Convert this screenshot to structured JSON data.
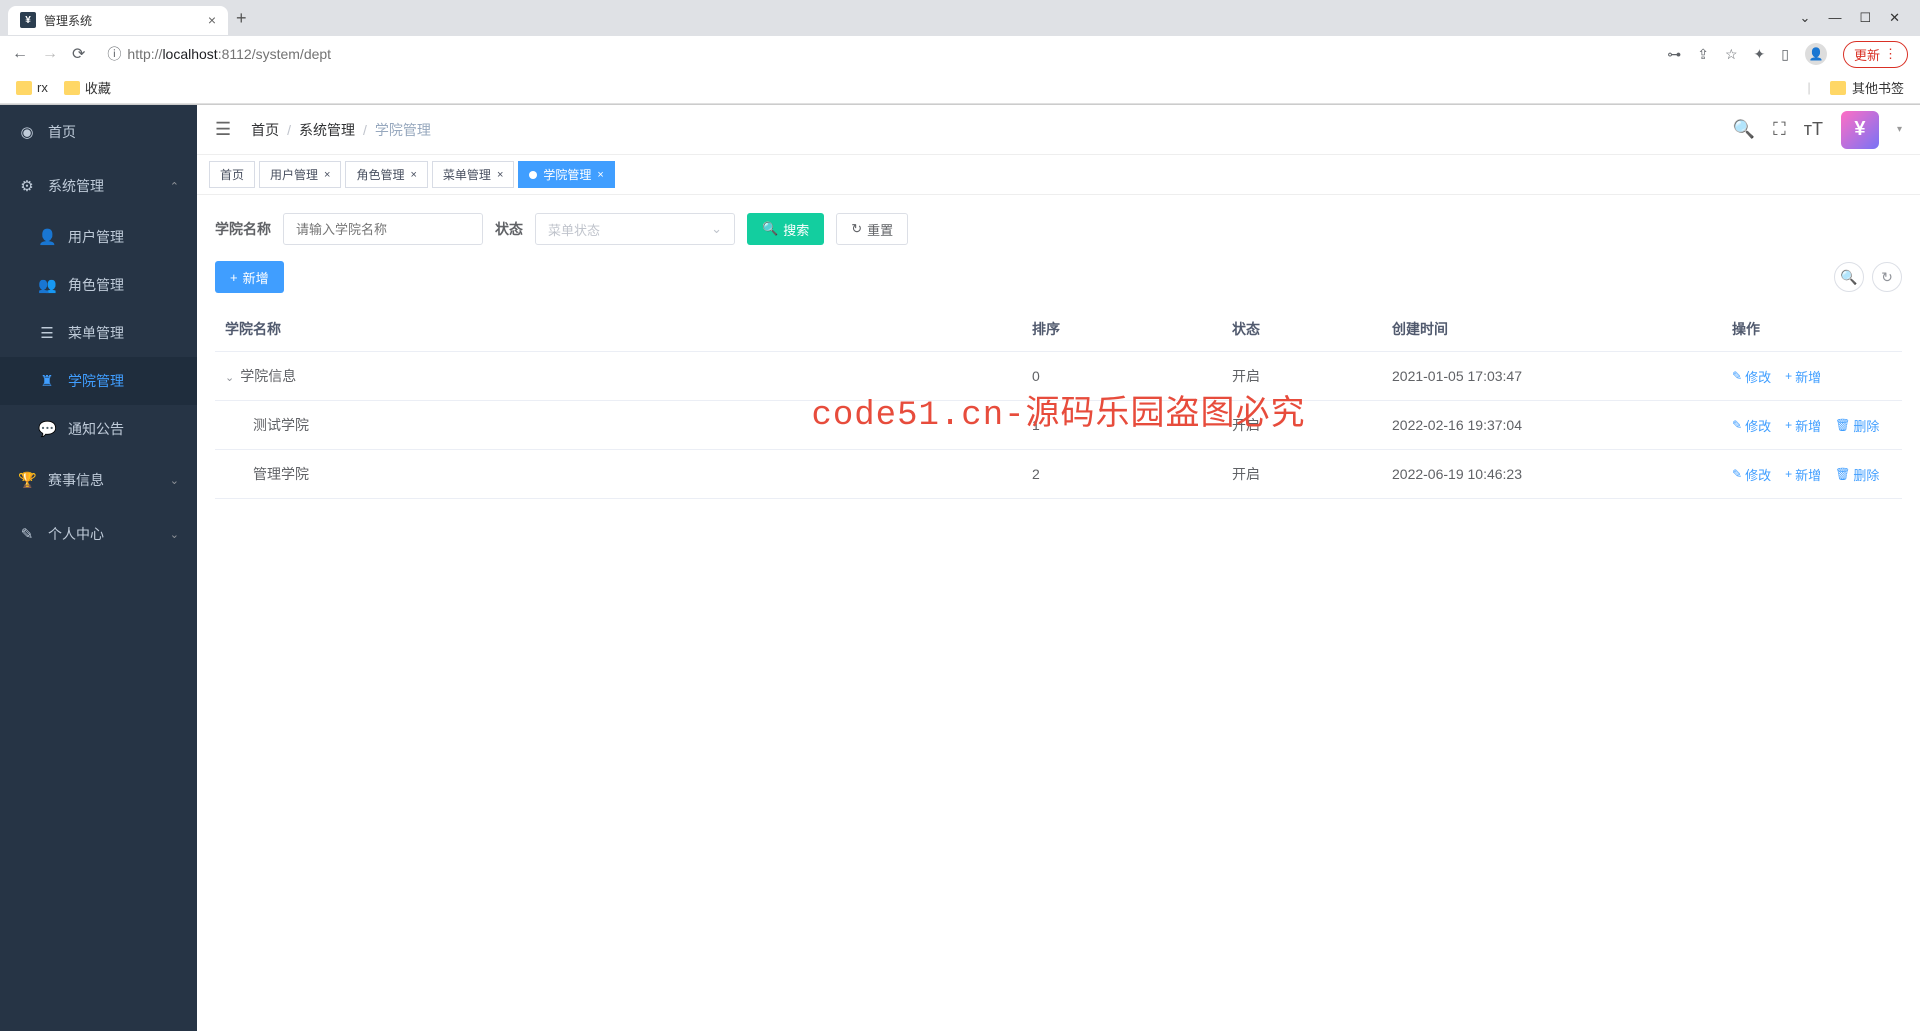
{
  "browser": {
    "tab_title": "管理系统",
    "url_host": "localhost",
    "url_port": ":8112",
    "url_path": "/system/dept",
    "url_prefix": "http://",
    "update_label": "更新",
    "bookmarks": {
      "rx": "rx",
      "fav": "收藏",
      "other": "其他书签"
    }
  },
  "sidebar": {
    "items": [
      {
        "icon": "dashboard",
        "label": "首页"
      },
      {
        "icon": "gear",
        "label": "系统管理",
        "expanded": true
      },
      {
        "icon": "user",
        "label": "用户管理",
        "sub": true
      },
      {
        "icon": "users",
        "label": "角色管理",
        "sub": true
      },
      {
        "icon": "list",
        "label": "菜单管理",
        "sub": true
      },
      {
        "icon": "sitemap",
        "label": "学院管理",
        "sub": true,
        "active": true
      },
      {
        "icon": "chat",
        "label": "通知公告",
        "sub": true
      },
      {
        "icon": "trophy",
        "label": "赛事信息",
        "collapsed": true
      },
      {
        "icon": "edit",
        "label": "个人中心",
        "collapsed": true
      }
    ]
  },
  "breadcrumb": {
    "home": "首页",
    "sys": "系统管理",
    "current": "学院管理"
  },
  "tabs": [
    {
      "label": "首页",
      "closable": false
    },
    {
      "label": "用户管理",
      "closable": true
    },
    {
      "label": "角色管理",
      "closable": true
    },
    {
      "label": "菜单管理",
      "closable": true
    },
    {
      "label": "学院管理",
      "closable": true,
      "active": true
    }
  ],
  "search": {
    "name_label": "学院名称",
    "name_placeholder": "请输入学院名称",
    "status_label": "状态",
    "status_placeholder": "菜单状态",
    "search_btn": "搜索",
    "reset_btn": "重置"
  },
  "toolbar": {
    "add_btn": "新增"
  },
  "table": {
    "headers": {
      "name": "学院名称",
      "sort": "排序",
      "status": "状态",
      "created": "创建时间",
      "ops": "操作"
    },
    "actions": {
      "edit": "修改",
      "add": "新增",
      "del": "删除"
    },
    "rows": [
      {
        "name": "学院信息",
        "sort": "0",
        "status": "开启",
        "created": "2021-01-05 17:03:47",
        "expandable": true,
        "deletable": false
      },
      {
        "name": "测试学院",
        "sort": "1",
        "status": "开启",
        "created": "2022-02-16 19:37:04",
        "indent": true,
        "deletable": true
      },
      {
        "name": "管理学院",
        "sort": "2",
        "status": "开启",
        "created": "2022-06-19 10:46:23",
        "indent": true,
        "deletable": true
      }
    ]
  },
  "watermark": "code51.cn-源码乐园盗图必究"
}
